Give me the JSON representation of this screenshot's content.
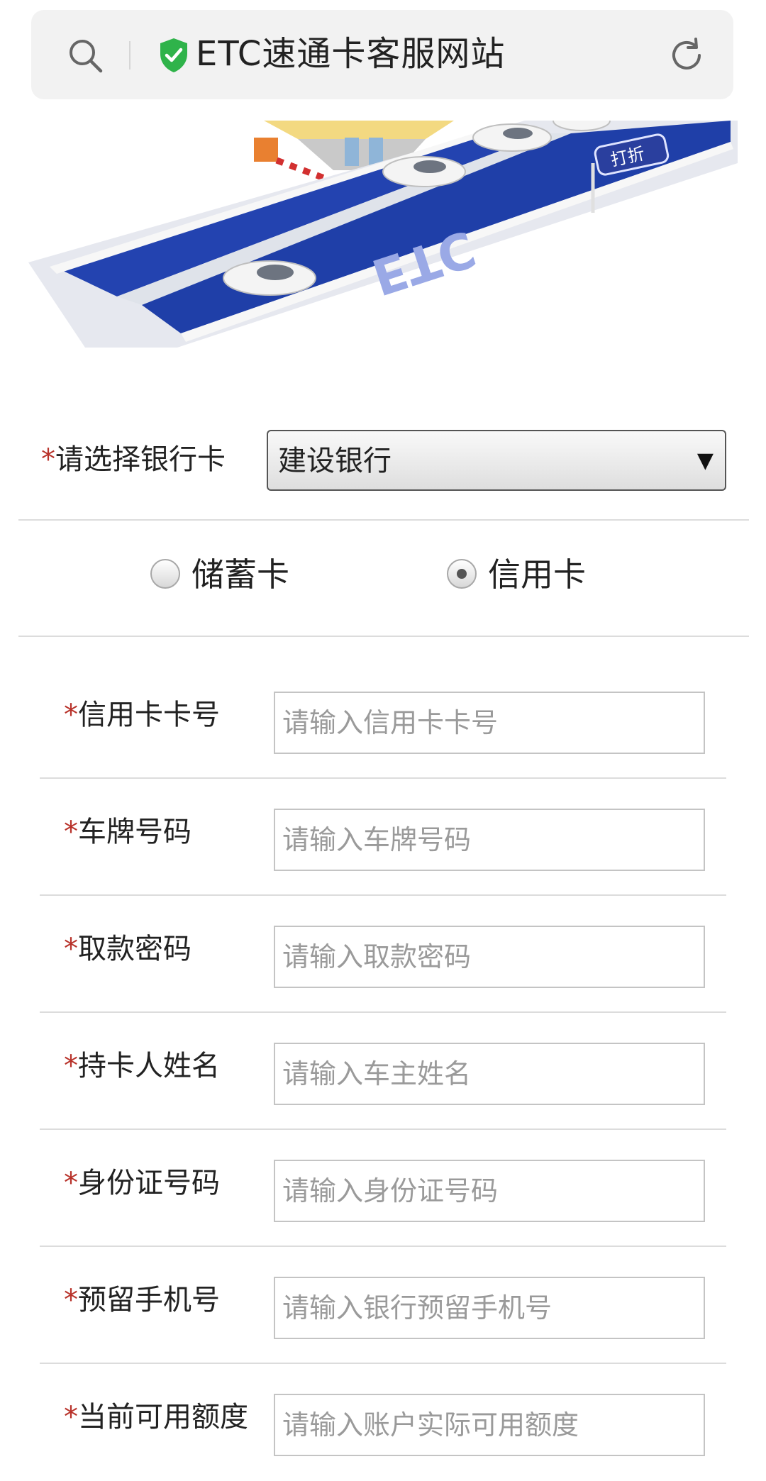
{
  "browser": {
    "site_title": "ETC速通卡客服网站",
    "icons": [
      "search-icon",
      "shield-check-icon",
      "refresh-icon"
    ]
  },
  "banner": {
    "sign_text": "打折",
    "road_text": "ETC"
  },
  "bank": {
    "label": "请选择银行卡",
    "required_mark": "*",
    "selected": "建设银行"
  },
  "card_type": {
    "options": [
      {
        "label": "储蓄卡",
        "selected": false
      },
      {
        "label": "信用卡",
        "selected": true
      }
    ]
  },
  "form": {
    "rows": [
      {
        "label": "信用卡卡号",
        "placeholder": "请输入信用卡卡号"
      },
      {
        "label": "车牌号码",
        "placeholder": "请输入车牌号码"
      },
      {
        "label": "取款密码",
        "placeholder": "请输入取款密码"
      },
      {
        "label": "持卡人姓名",
        "placeholder": "请输入车主姓名"
      },
      {
        "label": "身份证号码",
        "placeholder": "请输入身份证号码"
      },
      {
        "label": "预留手机号",
        "placeholder": "请输入银行预留手机号"
      },
      {
        "label": "当前可用额度",
        "placeholder": "请输入账户实际可用额度"
      }
    ]
  },
  "colors": {
    "required_star": "#b8322a",
    "shield_green": "#2fb34a",
    "road_blue": "#1f3fa8"
  }
}
